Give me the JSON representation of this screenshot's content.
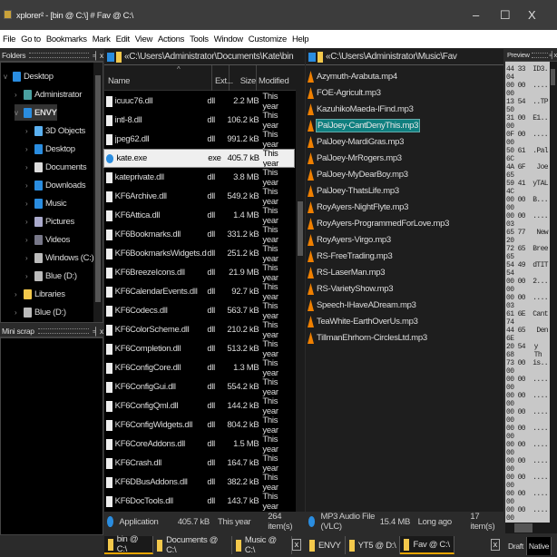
{
  "window": {
    "title": "xplorer² - [bin @ C:\\] # Fav @ C:\\",
    "minimize": "–",
    "maximize": "☐",
    "close": "X"
  },
  "menu": [
    "File",
    "Go to",
    "Bookmarks",
    "Mark",
    "Edit",
    "View",
    "Actions",
    "Tools",
    "Window",
    "Customize",
    "Help"
  ],
  "folders": {
    "title": "Folders",
    "pin": "╡",
    "close": "x",
    "items": [
      {
        "label": "Desktop",
        "level": 0,
        "expanded": true,
        "icon": "desktop-icon",
        "color": "#2a8de0"
      },
      {
        "label": "Administrator",
        "level": 1,
        "icon": "user-icon",
        "color": "#4aa0a0"
      },
      {
        "label": "ENVY",
        "level": 1,
        "expanded": true,
        "selected": true,
        "icon": "computer-icon",
        "color": "#2a8de0"
      },
      {
        "label": "3D Objects",
        "level": 2,
        "icon": "cube-icon",
        "color": "#5ab0f0"
      },
      {
        "label": "Desktop",
        "level": 2,
        "icon": "desktop-icon",
        "color": "#2a8de0"
      },
      {
        "label": "Documents",
        "level": 2,
        "icon": "document-icon",
        "color": "#ddd"
      },
      {
        "label": "Downloads",
        "level": 2,
        "icon": "download-icon",
        "color": "#2a8de0"
      },
      {
        "label": "Music",
        "level": 2,
        "icon": "music-icon",
        "color": "#2a8de0"
      },
      {
        "label": "Pictures",
        "level": 2,
        "icon": "picture-icon",
        "color": "#aac"
      },
      {
        "label": "Videos",
        "level": 2,
        "icon": "video-icon",
        "color": "#778"
      },
      {
        "label": "Windows (C:)",
        "level": 2,
        "icon": "drive-icon",
        "color": "#bbb"
      },
      {
        "label": "Blue (D:)",
        "level": 2,
        "icon": "drive-icon",
        "color": "#bbb"
      },
      {
        "label": "Libraries",
        "level": 1,
        "icon": "library-icon",
        "color": "#f3c84b"
      },
      {
        "label": "Blue (D:)",
        "level": 1,
        "icon": "drive-icon",
        "color": "#bbb"
      }
    ]
  },
  "miniscrap": {
    "title": "Mini scrap",
    "pin": "╡",
    "close": "x"
  },
  "left": {
    "path": "«C:\\Users\\Administrator\\Documents\\Kate\\bin",
    "columns": {
      "name": "Name",
      "ext": "Ext...",
      "size": "Size",
      "modified": "Modified"
    },
    "files": [
      [
        "icuuc76.dll",
        "dll",
        "2.2 MB",
        "This year"
      ],
      [
        "intl-8.dll",
        "dll",
        "106.2 kB",
        "This year"
      ],
      [
        "jpeg62.dll",
        "dll",
        "991.2 kB",
        "This year"
      ],
      [
        "kate.exe",
        "exe",
        "405.7 kB",
        "This year"
      ],
      [
        "kateprivate.dll",
        "dll",
        "3.8 MB",
        "This year"
      ],
      [
        "KF6Archive.dll",
        "dll",
        "549.2 kB",
        "This year"
      ],
      [
        "KF6Attica.dll",
        "dll",
        "1.4 MB",
        "This year"
      ],
      [
        "KF6Bookmarks.dll",
        "dll",
        "331.2 kB",
        "This year"
      ],
      [
        "KF6BookmarksWidgets.dll",
        "dll",
        "251.2 kB",
        "This year"
      ],
      [
        "KF6BreezeIcons.dll",
        "dll",
        "21.9 MB",
        "This year"
      ],
      [
        "KF6CalendarEvents.dll",
        "dll",
        "92.7 kB",
        "This year"
      ],
      [
        "KF6Codecs.dll",
        "dll",
        "563.7 kB",
        "This year"
      ],
      [
        "KF6ColorScheme.dll",
        "dll",
        "210.2 kB",
        "This year"
      ],
      [
        "KF6Completion.dll",
        "dll",
        "513.2 kB",
        "This year"
      ],
      [
        "KF6ConfigCore.dll",
        "dll",
        "1.3 MB",
        "This year"
      ],
      [
        "KF6ConfigGui.dll",
        "dll",
        "554.2 kB",
        "This year"
      ],
      [
        "KF6ConfigQml.dll",
        "dll",
        "144.2 kB",
        "This year"
      ],
      [
        "KF6ConfigWidgets.dll",
        "dll",
        "804.2 kB",
        "This year"
      ],
      [
        "KF6CoreAddons.dll",
        "dll",
        "1.5 MB",
        "This year"
      ],
      [
        "KF6Crash.dll",
        "dll",
        "164.7 kB",
        "This year"
      ],
      [
        "KF6DBusAddons.dll",
        "dll",
        "382.2 kB",
        "This year"
      ],
      [
        "KF6DocTools.dll",
        "dll",
        "143.7 kB",
        "This year"
      ]
    ],
    "selected_index": 3,
    "status": {
      "type": "Application",
      "size": "405.7 kB",
      "date": "This year",
      "count": "264 item(s)"
    }
  },
  "right": {
    "path": "«C:\\Users\\Administrator\\Music\\Fav",
    "files": [
      "Azymuth-Arabuta.mp4",
      "FOE-Agricult.mp3",
      "KazuhikoMaeda-IFind.mp3",
      "PalJoey-CantDenyThis.mp3",
      "PalJoey-MardiGras.mp3",
      "PalJoey-MrRogers.mp3",
      "PalJoey-MyDearBoy.mp3",
      "PalJoey-ThatsLife.mp3",
      "RoyAyers-NightFlyte.mp3",
      "RoyAyers-ProgrammedForLove.mp3",
      "RoyAyers-Virgo.mp3",
      "RS-FreeTrading.mp3",
      "RS-LaserMan.mp3",
      "RS-VarietyShow.mp3",
      "Speech-IHaveADream.mp3",
      "TeaWhite-EarthOverUs.mp3",
      "TillmanEhrhorn-CirclesLtd.mp3"
    ],
    "selected_index": 3,
    "status": {
      "type": "MP3 Audio File (VLC)",
      "size": "15.4 MB",
      "date": "Long ago",
      "count": "17 item(s)"
    }
  },
  "tabs_left": [
    {
      "label": "bin @ C:\\",
      "active": true
    },
    {
      "label": "Documents @ C:\\"
    },
    {
      "label": "Music @ C:\\"
    }
  ],
  "tabs_right": [
    {
      "label": "ENVY"
    },
    {
      "label": "YT5 @ D:\\"
    },
    {
      "label": "Fav @ C:\\",
      "active": true
    }
  ],
  "tab_close": "x",
  "preview": {
    "title": "Preview",
    "pin": "╡",
    "close": "x",
    "hex": [
      [
        "44 33 04",
        "ID3."
      ],
      [
        "00 00 00",
        "...."
      ],
      [
        "13 54 50",
        "..TP"
      ],
      [
        "31 00 00",
        "E1.."
      ],
      [
        "0F 00 00",
        "...."
      ],
      [
        "50 61 6C",
        ".Pal"
      ],
      [
        "4A 6F 65",
        " Joe"
      ],
      [
        "59 41 4C",
        "yTAL"
      ],
      [
        "00 00 00",
        "B..."
      ],
      [
        "00 00 03",
        "...."
      ],
      [
        "65 77 20",
        " New"
      ],
      [
        "72 65 65",
        "Bree"
      ],
      [
        "54 49 54",
        "dTIT"
      ],
      [
        "00 00 00",
        "2..."
      ],
      [
        "00 00 03",
        "...."
      ],
      [
        "61 6E 74",
        "Cant"
      ],
      [
        "44 65 6E",
        " Den"
      ],
      [
        "20 54 68",
        "y Th"
      ],
      [
        "73 00 00",
        "is.."
      ],
      [
        "00 00 00",
        "...."
      ],
      [
        "00 00 00",
        "...."
      ],
      [
        "00 00 00",
        "...."
      ],
      [
        "00 00 00",
        "...."
      ],
      [
        "00 00 00",
        "...."
      ],
      [
        "00 00 00",
        "...."
      ],
      [
        "00 00 00",
        "...."
      ],
      [
        "00 00 00",
        "...."
      ],
      [
        "00 00 00",
        "...."
      ]
    ],
    "tabs": [
      "Draft",
      "Native"
    ]
  }
}
